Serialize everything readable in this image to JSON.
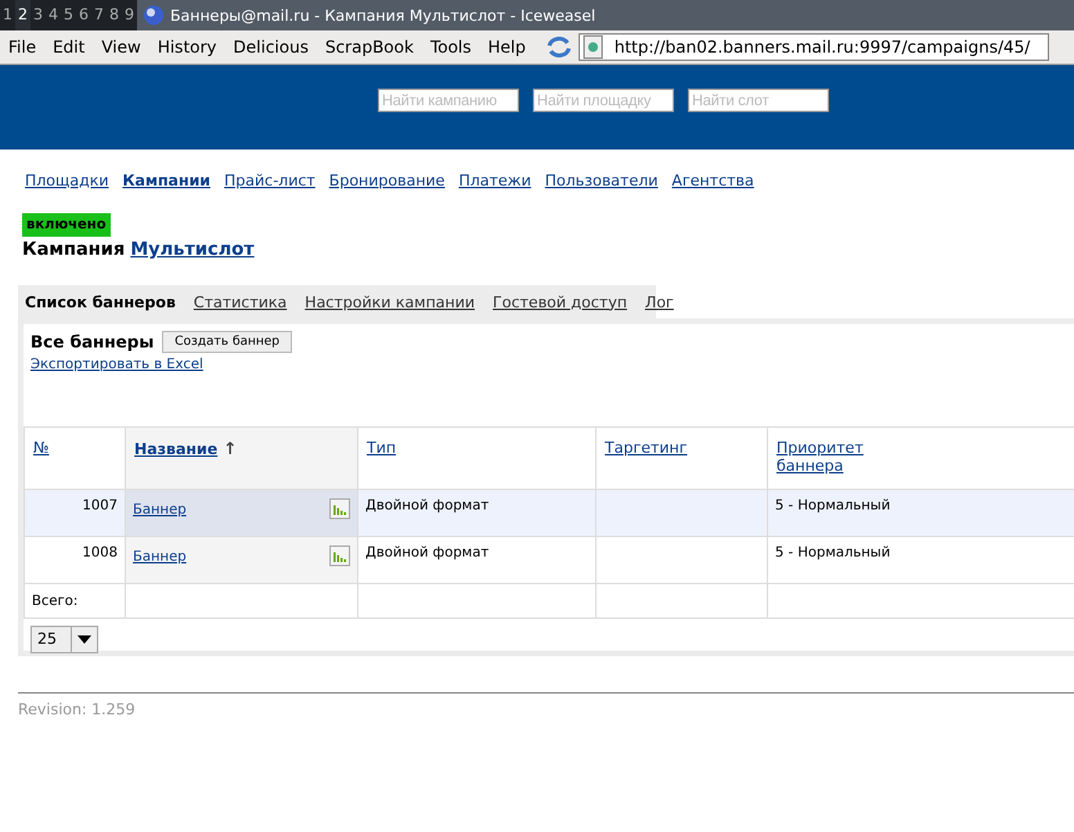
{
  "workspaces": [
    {
      "label": "1",
      "selected": false
    },
    {
      "label": "2",
      "selected": true
    },
    {
      "label": "3",
      "selected": false
    },
    {
      "label": "4",
      "selected": false
    },
    {
      "label": "5",
      "selected": false
    },
    {
      "label": "6",
      "selected": false
    },
    {
      "label": "7",
      "selected": false
    },
    {
      "label": "8",
      "selected": false
    },
    {
      "label": "9",
      "selected": false
    }
  ],
  "window": {
    "title": "Баннеры@mail.ru - Кампания Мультислот - Iceweasel"
  },
  "menu": [
    "File",
    "Edit",
    "View",
    "History",
    "Delicious",
    "ScrapBook",
    "Tools",
    "Help"
  ],
  "address": "http://ban02.banners.mail.ru:9997/campaigns/45/",
  "search_fields": [
    {
      "placeholder": "Найти кампанию"
    },
    {
      "placeholder": "Найти площадку"
    },
    {
      "placeholder": "Найти слот"
    }
  ],
  "nav": [
    {
      "label": "Площадки",
      "selected": false
    },
    {
      "label": "Кампании",
      "selected": true
    },
    {
      "label": "Прайс-лист",
      "selected": false
    },
    {
      "label": "Бронирование",
      "selected": false
    },
    {
      "label": "Платежи",
      "selected": false
    },
    {
      "label": "Пользователи",
      "selected": false
    },
    {
      "label": "Агентства",
      "selected": false
    }
  ],
  "status_badge": {
    "label": "включено",
    "color": "#19c019"
  },
  "campaign": {
    "prefix": "Кампания",
    "name": "Мультислот"
  },
  "tabs": [
    {
      "label": "Список баннеров",
      "selected": true
    },
    {
      "label": "Статистика",
      "selected": false
    },
    {
      "label": "Настройки кампании",
      "selected": false
    },
    {
      "label": "Гостевой доступ",
      "selected": false
    },
    {
      "label": "Лог",
      "selected": false
    }
  ],
  "panel": {
    "title": "Все баннеры",
    "create_button": "Создать баннер",
    "export_link": "Экспортировать в Excel"
  },
  "table": {
    "columns": [
      {
        "label": "№",
        "sorted": false
      },
      {
        "label": "Название",
        "sorted": true,
        "sort_arrow": "↑"
      },
      {
        "label": "Тип",
        "sorted": false
      },
      {
        "label": "Таргетинг",
        "sorted": false
      },
      {
        "label": "Приоритет баннера",
        "sorted": false
      }
    ],
    "rows": [
      {
        "id": "1007",
        "name": "Баннер",
        "type": "Двойной формат",
        "targeting": "",
        "priority": "5 - Нормальный",
        "highlighted": true
      },
      {
        "id": "1008",
        "name": "Баннер",
        "type": "Двойной формат",
        "targeting": "",
        "priority": "5 - Нормальный",
        "highlighted": false
      }
    ],
    "total_label": "Всего:"
  },
  "page_size": "25",
  "footer": "Revision: 1.259"
}
